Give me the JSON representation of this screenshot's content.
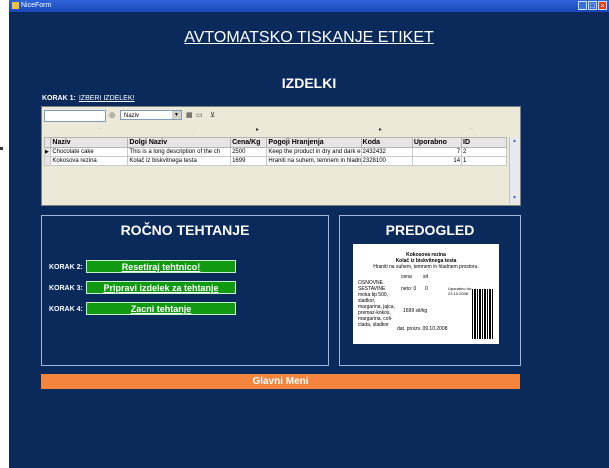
{
  "window": {
    "title": "NiceForm",
    "minimize": "_",
    "maximize": "□",
    "close": "×"
  },
  "header": {
    "title": "AVTOMATSKO TISKANJE ETIKET",
    "section": "IZDELKI"
  },
  "step1": {
    "label": "KORAK 1:",
    "link": "IZBERI IZDELEK!"
  },
  "toolbar": {
    "search_value": "",
    "combo_value": "Naziv",
    "find_icon": "binoculars-icon"
  },
  "group_row": [
    "··",
    "·",
    "▸",
    "▸",
    "··"
  ],
  "grid": {
    "columns": [
      "Naziv",
      "Dolgi Naziv",
      "Cena/Kg",
      "Pogoji Hranjenja",
      "Koda",
      "Uporabno",
      "ID"
    ],
    "rows": [
      [
        "Chocolate cake",
        "This is a long description of the ch",
        "2500",
        "Keep the product in dry and dark environme",
        "2432432",
        "7",
        "2"
      ],
      [
        "Kokosova rezina",
        "Kolač iz biskvitnega testa",
        "1699",
        "Hraniti na suhem, temnem in hladnem pros",
        "2328100",
        "14",
        "1"
      ]
    ],
    "selected_marker": "▶"
  },
  "weighing": {
    "title": "ROČNO TEHTANJE",
    "steps": [
      {
        "label": "KORAK 2:",
        "button": "Resetiraj tehtnico!"
      },
      {
        "label": "KORAK 3:",
        "button": "Pripravi izdelek za tehtanje"
      },
      {
        "label": "KORAK 4:",
        "button": "Zacni tehtanje"
      }
    ]
  },
  "preview": {
    "title": "PREDOGLED",
    "label": {
      "name": "Kokosova rezina",
      "desc": "Kolač iz biskvitnega testa",
      "storage": "Hraniti na suhem, temnem in hladnem prostoru.",
      "price_head": "cena",
      "unit_head": "sit",
      "ingredients": "OSNOVNE SESTAVINE moka tip 500, sladkor, margarina, jajca, premaz-kokos, margarina, coli-clada, sladkor",
      "net": "neto: 0",
      "gross": "0",
      "use_by": "Uporabno do: 23.10.2008",
      "price_kg": "1699 sit/kg",
      "date": "dat. proizv. 09.10.2008"
    }
  },
  "footer": {
    "main_menu": "Glavni Meni"
  }
}
